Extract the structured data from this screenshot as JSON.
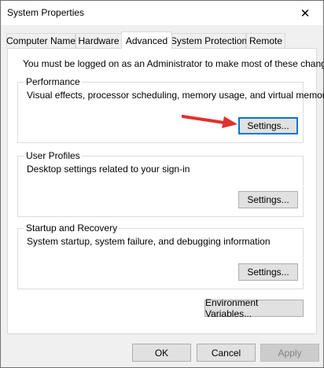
{
  "window": {
    "title": "System Properties",
    "close_glyph": "✕"
  },
  "tabs": [
    {
      "label": "Computer Name",
      "selected": false
    },
    {
      "label": "Hardware",
      "selected": false
    },
    {
      "label": "Advanced",
      "selected": true
    },
    {
      "label": "System Protection",
      "selected": false
    },
    {
      "label": "Remote",
      "selected": false
    }
  ],
  "advanced": {
    "admin_note": "You must be logged on as an Administrator to make most of these changes.",
    "performance": {
      "title": "Performance",
      "description": "Visual effects, processor scheduling, memory usage, and virtual memory",
      "button": "Settings..."
    },
    "user_profiles": {
      "title": "User Profiles",
      "description": "Desktop settings related to your sign-in",
      "button": "Settings..."
    },
    "startup_recovery": {
      "title": "Startup and Recovery",
      "description": "System startup, system failure, and debugging information",
      "button": "Settings..."
    },
    "env_button": "Environment Variables..."
  },
  "footer": {
    "ok": "OK",
    "cancel": "Cancel",
    "apply": "Apply"
  },
  "colors": {
    "window_bg": "#f0f0f0",
    "panel_bg": "#ffffff",
    "focus_border": "#0078d7",
    "arrow": "#e0312e",
    "disabled_text": "#838383"
  },
  "annotation": {
    "icon": "red-arrow-icon"
  }
}
